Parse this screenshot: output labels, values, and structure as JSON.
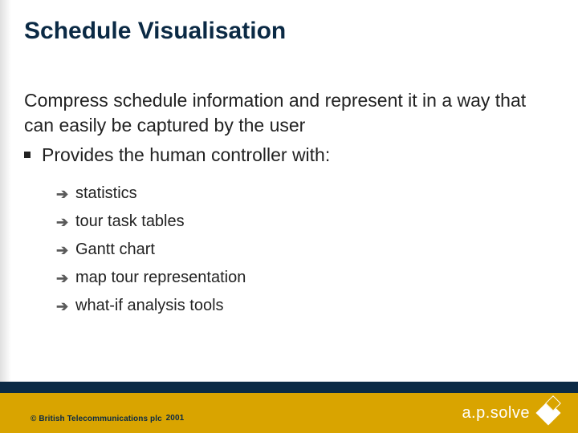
{
  "title": "Schedule Visualisation",
  "intro": "Compress schedule information and represent it in a way that can easily be captured by the user",
  "level1": "Provides the human controller with:",
  "subs": {
    "s0": "statistics",
    "s1": "tour task tables",
    "s2": "Gantt chart",
    "s3": "map tour representation",
    "s4": "what-if analysis tools"
  },
  "footer": {
    "copyright_prefix": "© British Telecommunications plc",
    "year": "2001",
    "logo_text": "a.p.solve"
  }
}
